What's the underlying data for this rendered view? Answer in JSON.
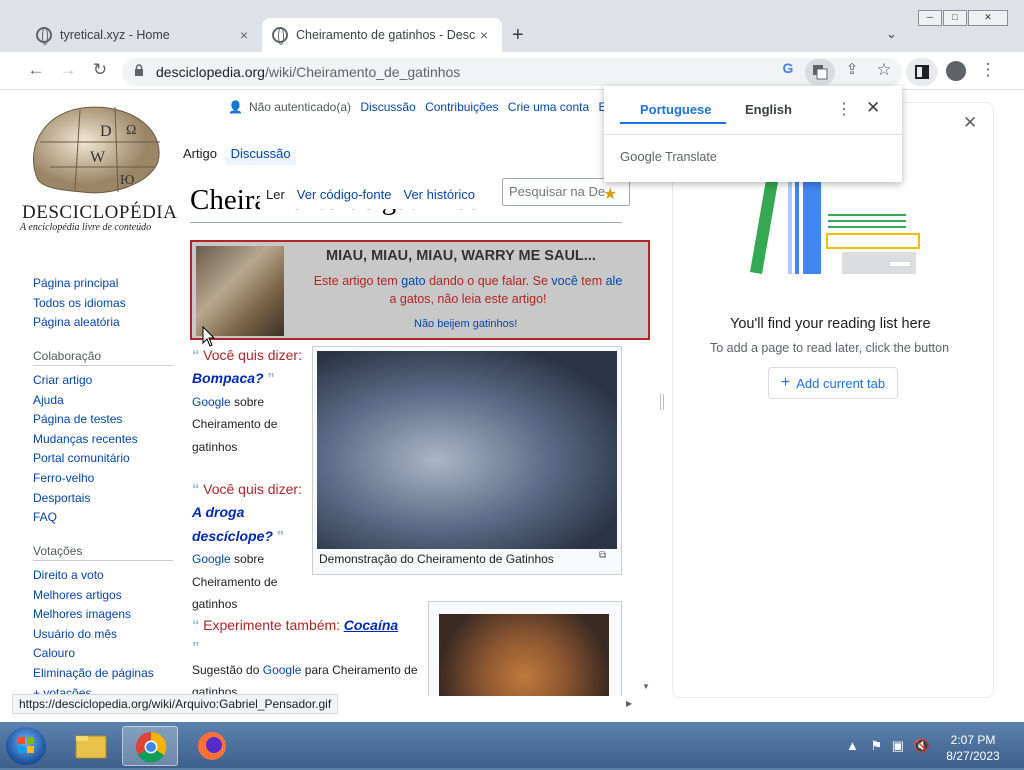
{
  "browser": {
    "tabs": [
      {
        "title": "tyretical.xyz - Home",
        "close": "×"
      },
      {
        "title": "Cheiramento de gatinhos - Desc",
        "close": "×"
      }
    ],
    "new_tab": "+",
    "url_host": "desciclopedia.org",
    "url_path": "/wiki/Cheiramento_de_gatinhos",
    "status_url": "https://desciclopedia.org/wiki/Arquivo:Gabriel_Pensador.gif",
    "window_controls": [
      "─",
      "□",
      "✕"
    ]
  },
  "site": {
    "logo_name": "DESCICLOPÉDIA",
    "logo_tagline": "A enciclopédia livre de conteúdo",
    "personal": [
      "Não autenticado(a)",
      "Discussão",
      "Contribuições",
      "Crie uma conta",
      "En"
    ],
    "tabs": [
      "Artigo",
      "Discussão"
    ],
    "views": [
      "Ler",
      "Ver código-fonte",
      "Ver histórico"
    ],
    "search_placeholder": "Pesquisar na De",
    "nav_main": [
      "Página principal",
      "Todos os idiomas",
      "Página aleatória"
    ],
    "collab_heading": "Colaboração",
    "nav_collab": [
      "Criar artigo",
      "Ajuda",
      "Página de testes",
      "Mudanças recentes",
      "Portal comunitário",
      "Ferro-velho",
      "Desportais",
      "FAQ"
    ],
    "votes_heading": "Votações",
    "nav_votes": [
      "Direito a voto",
      "Melhores artigos",
      "Melhores imagens",
      "Usuário do mês",
      "Calouro",
      "Eliminação de páginas",
      "+ votações"
    ]
  },
  "article": {
    "title": "Cheiramento de gatinhos",
    "banner": {
      "heading": "MIAU, MIAU, MIAU, WARRY ME SAUL...",
      "text_a": "Este artigo tem ",
      "link_gato": "gato",
      "text_b": " dando o que falar. Se ",
      "link_voce": "você",
      "text_c": " tem ",
      "link_ale": "ale",
      "text_d": "a gatos, não leia este artigo!",
      "footer": "Não beijem gatinhos!"
    },
    "quote1": {
      "lead": "Você quis dizer:",
      "term": "Bompaca?",
      "google": "Google",
      "rest": " sobre Cheiramento de gatinhos"
    },
    "quote2": {
      "lead": "Você quis dizer:",
      "term": "A droga descíclope?",
      "google": "Google",
      "rest": " sobre Cheiramento de gatinhos"
    },
    "quote3": {
      "lead": "Experimente também:",
      "term": "Cocaína"
    },
    "sugestao_a": "Sugestão do ",
    "sugestao_google": "Google",
    "sugestao_b": " para Cheiramento de gatinhos",
    "thumb1_caption": "Demonstração do Cheiramento de Gatinhos"
  },
  "reading_list": {
    "title": "You'll find your reading list here",
    "subtitle": "To add a page to read later, click the button",
    "button": "Add current tab"
  },
  "translate": {
    "lang_source": "Portuguese",
    "lang_target": "English",
    "brand_a": "Google",
    "brand_b": " Translate"
  },
  "taskbar": {
    "time": "2:07 PM",
    "date": "8/27/2023"
  },
  "colors": {
    "accent": "#1a73e8",
    "banner_border": "#b32424",
    "link": "#0645ad"
  }
}
